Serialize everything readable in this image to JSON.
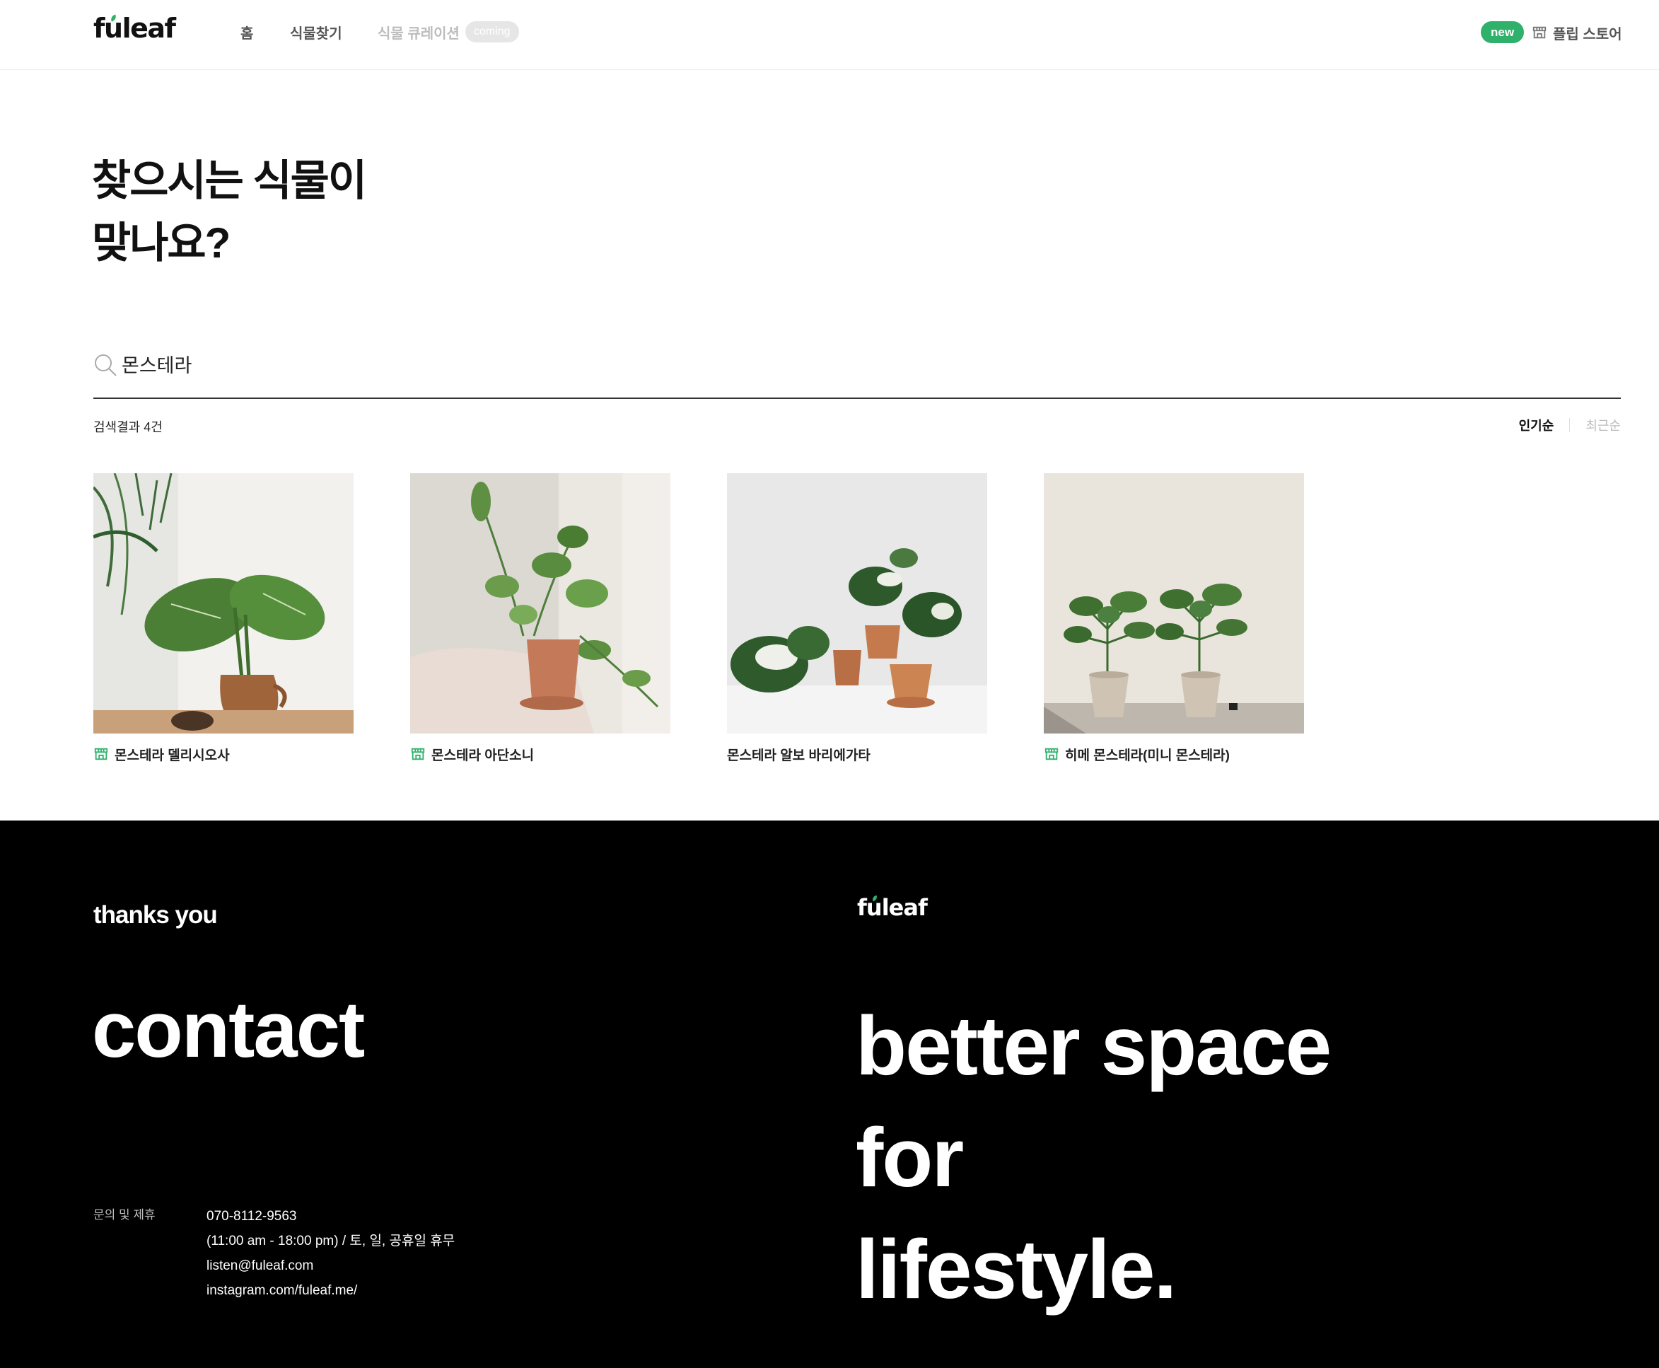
{
  "header": {
    "logo_pre": "f",
    "logo_u": "u",
    "logo_post": "leaf",
    "nav": [
      "홈",
      "식물찾기",
      "식물 큐레이션"
    ],
    "coming_badge": "coming",
    "new_badge": "new",
    "store_label": "플립 스토어"
  },
  "title": {
    "line1": "찾으시는 식물이",
    "line2": "맞나요?"
  },
  "search": {
    "value": "몬스테라",
    "icon": "search-icon"
  },
  "results": {
    "count_text": "검색결과 4건",
    "sort_options": [
      "인기순",
      "최근순"
    ],
    "sort_selected": "인기순"
  },
  "products": [
    {
      "name": "몬스테라 델리시오사",
      "store_icon": true
    },
    {
      "name": "몬스테라 아단소니",
      "store_icon": true
    },
    {
      "name": "몬스테라 알보 바리에가타",
      "store_icon": false
    },
    {
      "name": "히메 몬스테라(미니 몬스테라)",
      "store_icon": true
    }
  ],
  "footer": {
    "thanks": "thanks you",
    "contact_title": "contact",
    "inquiry_label": "문의 및 제휴",
    "phone": "070-8112-9563",
    "hours": "(11:00 am - 18:00 pm) / 토, 일, 공휴일 휴무",
    "email": "listen@fuleaf.com",
    "instagram": "instagram.com/fuleaf.me/",
    "logo_pre": "f",
    "logo_u": "u",
    "logo_post": "leaf",
    "slogan": [
      "better space",
      "for",
      "lifestyle."
    ]
  },
  "colors": {
    "accent_green": "#2fb16b",
    "footer_bg": "#000000"
  }
}
